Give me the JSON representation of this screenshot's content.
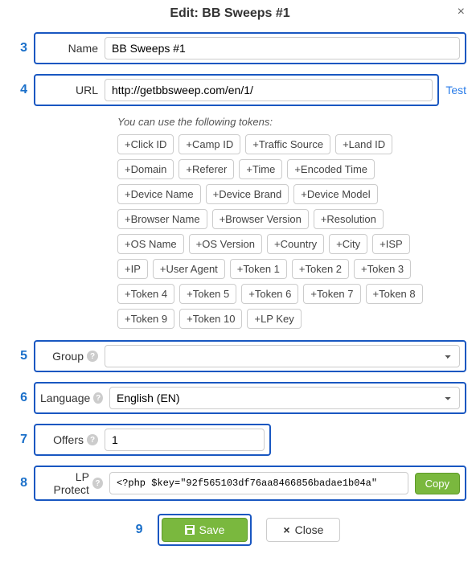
{
  "title": "Edit: BB Sweeps #1",
  "close_x": "×",
  "annotations": {
    "n3": "3",
    "n4": "4",
    "n5": "5",
    "n6": "6",
    "n7": "7",
    "n8": "8",
    "n9": "9"
  },
  "labels": {
    "name": "Name",
    "url": "URL",
    "group": "Group",
    "language": "Language",
    "offers": "Offers",
    "lp_protect": "LP Protect"
  },
  "values": {
    "name": "BB Sweeps #1",
    "url": "http://getbbsweep.com/en/1/",
    "group": "",
    "language": "English (EN)",
    "offers": "1",
    "lp_protect": "<?php $key=\"92f565103df76aa8466856badae1b04a\""
  },
  "links": {
    "test": "Test"
  },
  "tokens_hint": "You can use the following tokens:",
  "tokens": [
    "+Click ID",
    "+Camp ID",
    "+Traffic Source",
    "+Land ID",
    "+Domain",
    "+Referer",
    "+Time",
    "+Encoded Time",
    "+Device Name",
    "+Device Brand",
    "+Device Model",
    "+Browser Name",
    "+Browser Version",
    "+Resolution",
    "+OS Name",
    "+OS Version",
    "+Country",
    "+City",
    "+ISP",
    "+IP",
    "+User Agent",
    "+Token 1",
    "+Token 2",
    "+Token 3",
    "+Token 4",
    "+Token 5",
    "+Token 6",
    "+Token 7",
    "+Token 8",
    "+Token 9",
    "+Token 10",
    "+LP Key"
  ],
  "buttons": {
    "copy": "Copy",
    "save": "Save",
    "close": "Close"
  }
}
